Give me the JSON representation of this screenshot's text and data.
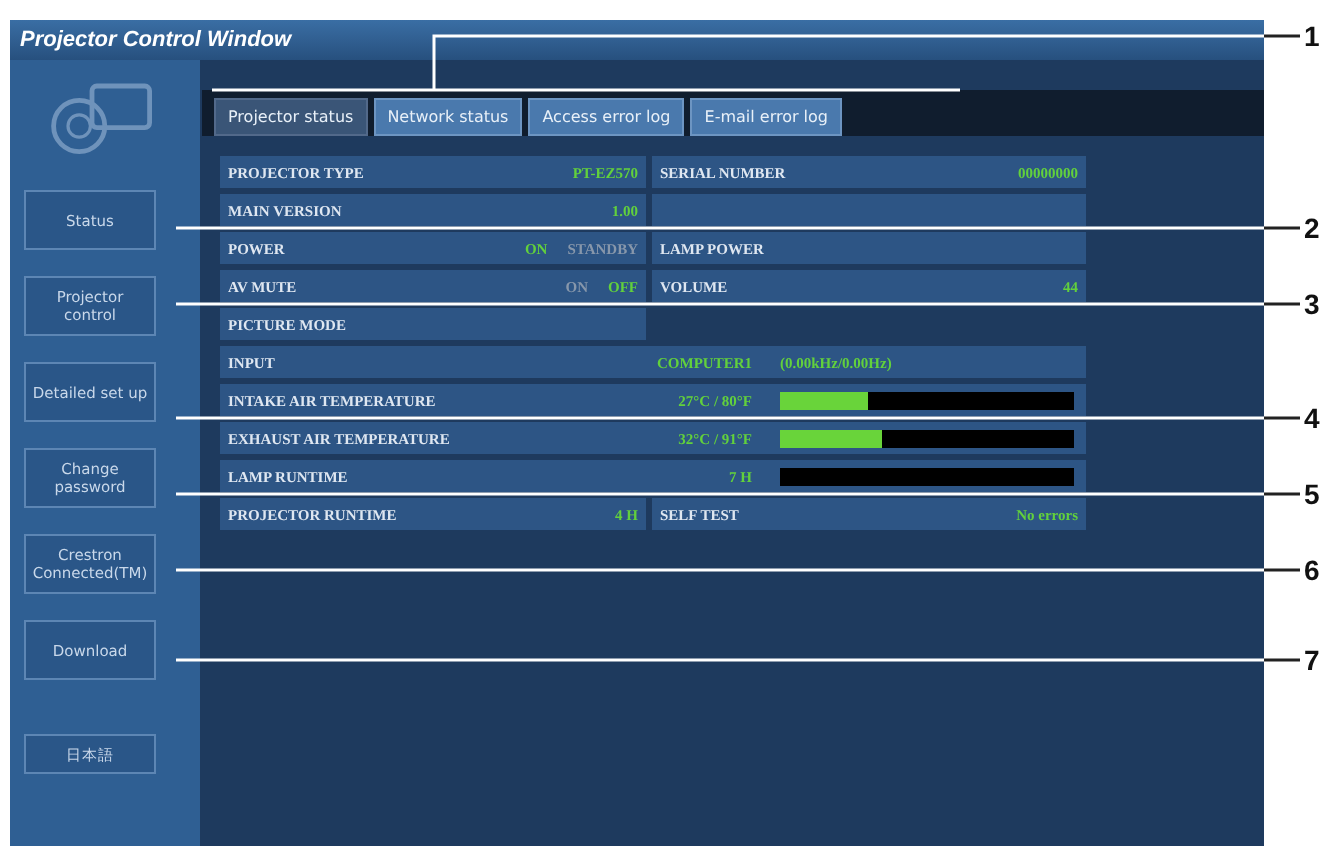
{
  "window": {
    "title": "Projector Control Window"
  },
  "sidebar": {
    "items": [
      {
        "label": "Status"
      },
      {
        "label": "Projector control"
      },
      {
        "label": "Detailed set up"
      },
      {
        "label": "Change password"
      },
      {
        "label": "Crestron Connected(TM)"
      },
      {
        "label": "Download"
      }
    ],
    "language_button": "日本語"
  },
  "tabs": [
    {
      "label": "Projector status",
      "selected": true
    },
    {
      "label": "Network status",
      "selected": false
    },
    {
      "label": "Access error log",
      "selected": false
    },
    {
      "label": "E-mail error log",
      "selected": false
    }
  ],
  "rows": [
    {
      "kind": "pair",
      "label": "PROJECTOR TYPE",
      "value": "PT-EZ570",
      "right_label": "SERIAL NUMBER",
      "right_value": "00000000"
    },
    {
      "kind": "pair",
      "label": "MAIN VERSION",
      "value": "1.00"
    },
    {
      "kind": "toggle",
      "label": "POWER",
      "options": [
        {
          "label": "ON",
          "selected": true
        },
        {
          "label": "STANDBY",
          "selected": false
        }
      ],
      "right_label": "LAMP POWER"
    },
    {
      "kind": "toggle",
      "label": "AV MUTE",
      "options": [
        {
          "label": "ON",
          "selected": false
        },
        {
          "label": "OFF",
          "selected": true
        }
      ],
      "right_label": "VOLUME",
      "right_value": "44"
    },
    {
      "kind": "single",
      "label": "PICTURE MODE"
    },
    {
      "kind": "wide",
      "label": "INPUT",
      "value": "COMPUTER1",
      "extra": "(0.00kHz/0.00Hz)"
    },
    {
      "kind": "meter",
      "label": "INTAKE AIR TEMPERATURE",
      "value": "27°C / 80°F",
      "level": 0.3
    },
    {
      "kind": "meter",
      "label": "EXHAUST AIR TEMPERATURE",
      "value": "32°C / 91°F",
      "level": 0.35
    },
    {
      "kind": "meter",
      "label": "LAMP RUNTIME",
      "value": "7 H"
    },
    {
      "kind": "pair",
      "label": "PROJECTOR RUNTIME",
      "value": "4 H",
      "right_label": "SELF TEST",
      "right_value": "No errors"
    }
  ],
  "callouts": [
    "1",
    "2",
    "3",
    "4",
    "5",
    "6",
    "7"
  ]
}
